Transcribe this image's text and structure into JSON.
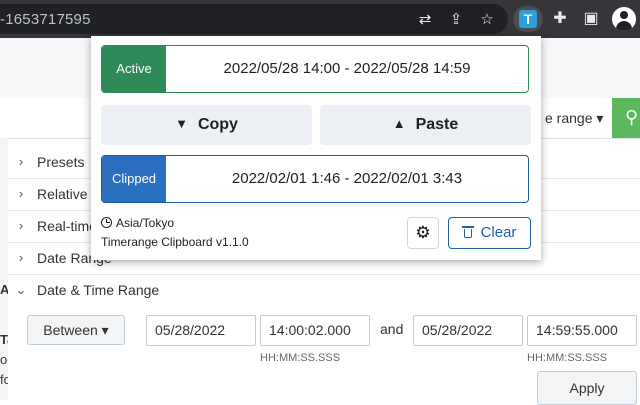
{
  "browser": {
    "url": "-1653717595",
    "extension_letter": "T"
  },
  "page": {
    "range_button_label": "e range ▾",
    "sections": [
      {
        "label": "Presets",
        "chevron": "›"
      },
      {
        "label": "Relative",
        "chevron": "›"
      },
      {
        "label": "Real-time",
        "chevron": "›"
      },
      {
        "label": "Date Range",
        "chevron": "›"
      },
      {
        "label": "Date & Time Range",
        "chevron": "⌄"
      }
    ],
    "edge_chars": [
      "A",
      "Ta",
      "o",
      "fo"
    ],
    "between_label": "Between ▾",
    "start_date": "05/28/2022",
    "start_time": "14:00:02.000",
    "and_label": "and",
    "end_date": "05/28/2022",
    "end_time": "14:59:55.000",
    "time_hint": "HH:MM:SS.SSS",
    "apply_label": "Apply"
  },
  "popup": {
    "active_tag": "Active",
    "active_range": "2022/05/28 14:00 - 2022/05/28 14:59",
    "copy_label": "Copy",
    "paste_label": "Paste",
    "clipped_tag": "Clipped",
    "clipped_range": "2022/02/01 1:46 - 2022/02/01 3:43",
    "timezone": "Asia/Tokyo",
    "version": "Timerange Clipboard v1.1.0",
    "clear_label": "Clear"
  },
  "colors": {
    "active": "#2e8b57",
    "clipped": "#2a6fc0",
    "clear": "#1f5ea8",
    "go_button": "#5cb85c",
    "extension_icon": "#2e9fd8"
  },
  "icons": {
    "translate": "translate-icon",
    "share": "share-icon",
    "bookmark": "star-icon",
    "extensions": "puzzle-icon",
    "sidebar": "side-panel-icon",
    "profile": "avatar-icon",
    "settings": "gear-icon",
    "clear": "trash-icon",
    "timezone": "clock-icon",
    "search": "search-icon"
  }
}
